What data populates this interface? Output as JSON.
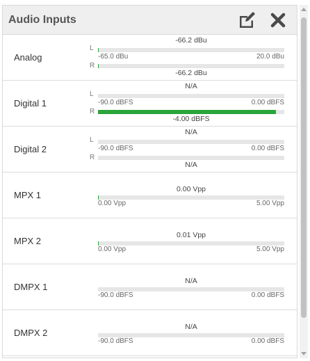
{
  "panel": {
    "title": "Audio Inputs",
    "icons": {
      "edit": "edit-icon",
      "close": "close-icon"
    }
  },
  "rows": [
    {
      "label": "Analog",
      "stereo": true,
      "top_value": "-66.2 dBu",
      "bottom_value": "-66.2 dBu",
      "scale_min": "-65.0 dBu",
      "scale_max": "20.0 dBu",
      "left_level": 0,
      "right_level": 0,
      "channels": [
        "L",
        "R"
      ]
    },
    {
      "label": "Digital 1",
      "stereo": true,
      "top_value": "N/A",
      "bottom_value": "-4.00 dBFS",
      "scale_min": "-90.0 dBFS",
      "scale_max": "0.00 dBFS",
      "left_level": null,
      "right_level": 0.955,
      "channels": [
        "L",
        "R"
      ]
    },
    {
      "label": "Digital 2",
      "stereo": true,
      "top_value": "N/A",
      "bottom_value": "N/A",
      "scale_min": "-90.0 dBFS",
      "scale_max": "0.00 dBFS",
      "left_level": null,
      "right_level": null,
      "channels": [
        "L",
        "R"
      ]
    },
    {
      "label": "MPX 1",
      "stereo": false,
      "top_value": "0.00 Vpp",
      "scale_min": "0.00 Vpp",
      "scale_max": "5.00 Vpp",
      "level": 0
    },
    {
      "label": "MPX 2",
      "stereo": false,
      "top_value": "0.01 Vpp",
      "scale_min": "0.00 Vpp",
      "scale_max": "5.00 Vpp",
      "level": 0
    },
    {
      "label": "DMPX 1",
      "stereo": false,
      "top_value": "N/A",
      "scale_min": "-90.0 dBFS",
      "scale_max": "0.00 dBFS",
      "level": null
    },
    {
      "label": "DMPX 2",
      "stereo": false,
      "top_value": "N/A",
      "scale_min": "-90.0 dBFS",
      "scale_max": "0.00 dBFS",
      "level": null
    }
  ],
  "colors": {
    "meter_fill": "#2aa53a",
    "meter_track": "#e6e6e6",
    "header_bg": "#efefef"
  }
}
